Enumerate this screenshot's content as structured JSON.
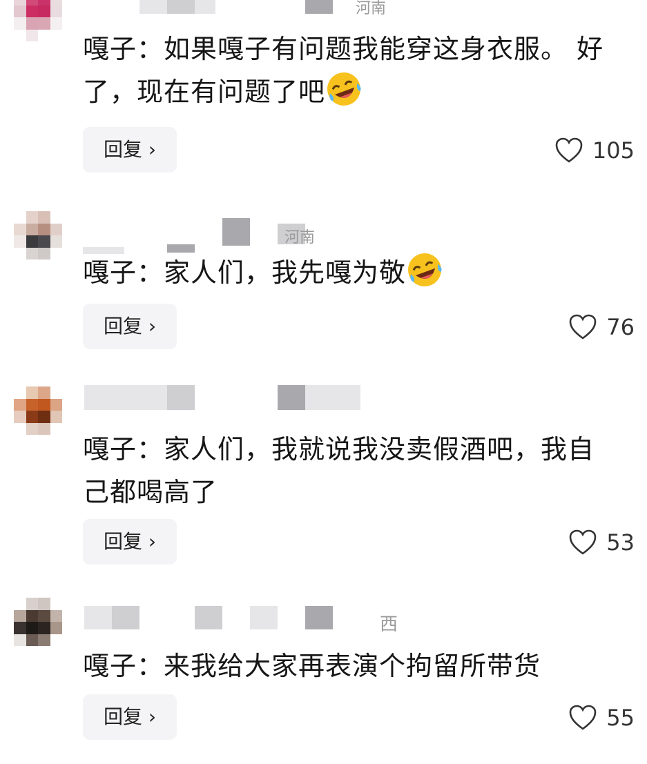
{
  "comments": [
    {
      "location": "河南",
      "text": "嘎子：如果嘎子有问题我能穿这身衣服。 好了，现在有问题了吧",
      "emoji": "rofl-emoji",
      "reply_label": "回复 ›",
      "likes": "105"
    },
    {
      "location": "河南",
      "text": "嘎子：家人们，我先嘎为敬",
      "emoji": "rofl-emoji",
      "reply_label": "回复 ›",
      "likes": "76"
    },
    {
      "location": "",
      "text": "嘎子：家人们，我就说我没卖假酒吧，我自己都喝高了",
      "emoji": "",
      "reply_label": "回复 ›",
      "likes": "53"
    },
    {
      "location": "西",
      "text": "嘎子：来我给大家再表演个拘留所带货",
      "emoji": "",
      "reply_label": "回复 ›",
      "likes": "55"
    }
  ],
  "colors": {
    "heart_outline": "#333333",
    "reply_bg": "#f4f4f6",
    "emoji_yellow": "#f7c21e"
  }
}
